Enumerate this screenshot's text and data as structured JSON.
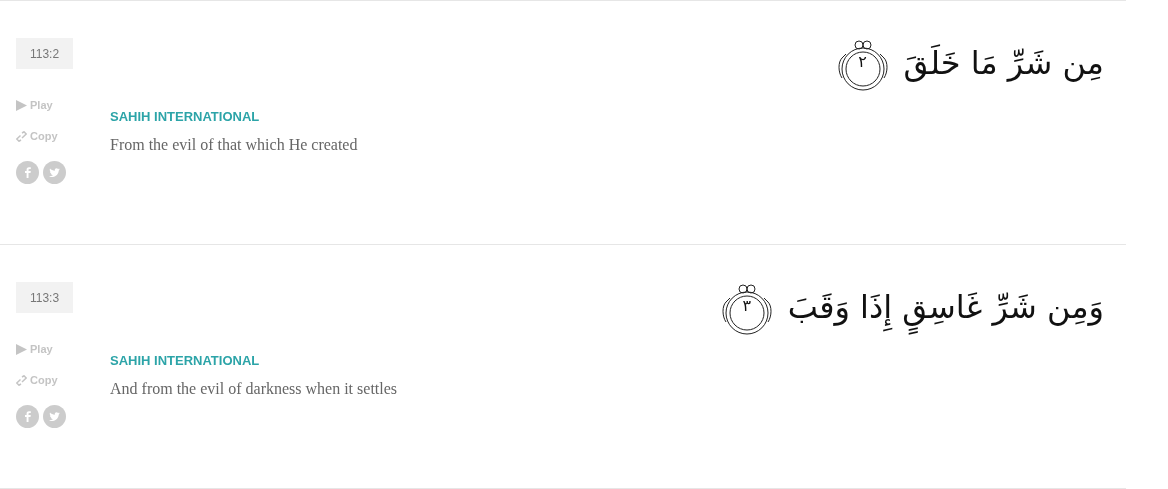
{
  "verses": [
    {
      "key": "113:2",
      "play": "Play",
      "copy": "Copy",
      "arabic": "مِن شَرِّ مَا خَلَقَ",
      "number": "٢",
      "translator": "SAHIH INTERNATIONAL",
      "translation": "From the evil of that which He created"
    },
    {
      "key": "113:3",
      "play": "Play",
      "copy": "Copy",
      "arabic": "وَمِن شَرِّ غَاسِقٍ إِذَا وَقَبَ",
      "number": "٣",
      "translator": "SAHIH INTERNATIONAL",
      "translation": "And from the evil of darkness when it settles"
    }
  ]
}
